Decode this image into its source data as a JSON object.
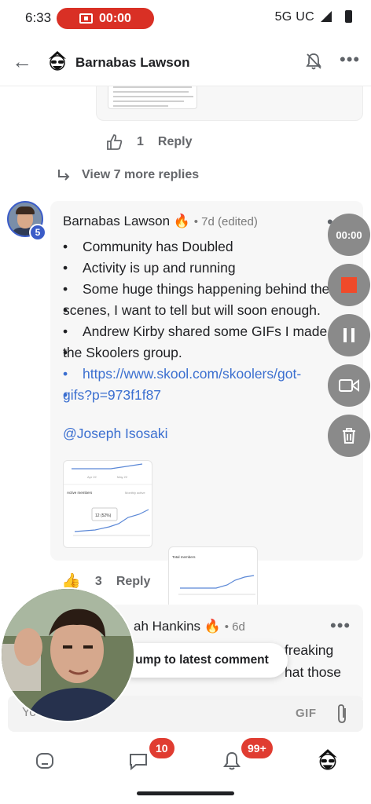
{
  "status_bar": {
    "time": "6:33",
    "recording_time": "00:00",
    "network": "5G UC"
  },
  "header": {
    "title": "Barnabas Lawson"
  },
  "previous_comment": {
    "like_count": "1",
    "reply_label": "Reply",
    "view_replies": "View 7 more replies"
  },
  "post": {
    "author": "Barnabas Lawson",
    "author_emoji": "🔥",
    "meta": "• 7d (edited)",
    "level": "5",
    "bullets": [
      "Community has Doubled",
      "Activity is up and running",
      "Some huge things happening behind the",
      "Andrew Kirby shared some GIFs I made in"
    ],
    "bullet_continuations": [
      "scenes, I want to tell but will soon enough.",
      "the Skoolers group."
    ],
    "link_line1": "https://www.skool.com/skoolers/got-",
    "link_line2": "gifs?p=973f1f87",
    "mention": "@Joseph Isosaki",
    "like_count": "3",
    "reply_label": "Reply",
    "thumb1": {
      "top_label": "Active members",
      "dropdown": "Monthly active",
      "tooltip": "12 (52%)"
    },
    "thumb2": {
      "top_label": "Total members",
      "bottom_label": "Active members",
      "dropdown": "Monthly active"
    }
  },
  "reply": {
    "name": "ah Hankins",
    "emoji": "🔥",
    "meta": "• 6d",
    "line1": "freaking",
    "line2": "hat those"
  },
  "jump_label": "ump to latest comment",
  "recorder": {
    "timer": "00:00"
  },
  "composer": {
    "placeholder": "Yo              ent",
    "gif_label": "GIF"
  },
  "nav": {
    "chat_badge": "10",
    "notif_badge": "99+"
  },
  "colors": {
    "accent_red": "#d93025",
    "link_blue": "#3b6fd0",
    "badge_red": "#e03c31"
  }
}
